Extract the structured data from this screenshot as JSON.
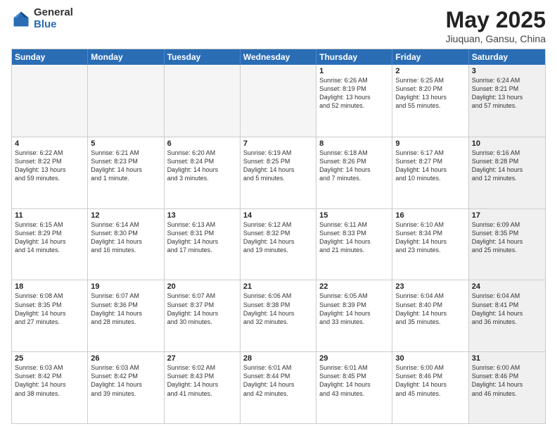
{
  "logo": {
    "general": "General",
    "blue": "Blue"
  },
  "header": {
    "title": "May 2025",
    "subtitle": "Jiuquan, Gansu, China"
  },
  "days": [
    "Sunday",
    "Monday",
    "Tuesday",
    "Wednesday",
    "Thursday",
    "Friday",
    "Saturday"
  ],
  "weeks": [
    [
      {
        "day": "",
        "info": "",
        "empty": true
      },
      {
        "day": "",
        "info": "",
        "empty": true
      },
      {
        "day": "",
        "info": "",
        "empty": true
      },
      {
        "day": "",
        "info": "",
        "empty": true
      },
      {
        "day": "1",
        "info": "Sunrise: 6:26 AM\nSunset: 8:19 PM\nDaylight: 13 hours\nand 52 minutes.",
        "empty": false
      },
      {
        "day": "2",
        "info": "Sunrise: 6:25 AM\nSunset: 8:20 PM\nDaylight: 13 hours\nand 55 minutes.",
        "empty": false
      },
      {
        "day": "3",
        "info": "Sunrise: 6:24 AM\nSunset: 8:21 PM\nDaylight: 13 hours\nand 57 minutes.",
        "empty": false,
        "shaded": true
      }
    ],
    [
      {
        "day": "4",
        "info": "Sunrise: 6:22 AM\nSunset: 8:22 PM\nDaylight: 13 hours\nand 59 minutes.",
        "empty": false
      },
      {
        "day": "5",
        "info": "Sunrise: 6:21 AM\nSunset: 8:23 PM\nDaylight: 14 hours\nand 1 minute.",
        "empty": false
      },
      {
        "day": "6",
        "info": "Sunrise: 6:20 AM\nSunset: 8:24 PM\nDaylight: 14 hours\nand 3 minutes.",
        "empty": false
      },
      {
        "day": "7",
        "info": "Sunrise: 6:19 AM\nSunset: 8:25 PM\nDaylight: 14 hours\nand 5 minutes.",
        "empty": false
      },
      {
        "day": "8",
        "info": "Sunrise: 6:18 AM\nSunset: 8:26 PM\nDaylight: 14 hours\nand 7 minutes.",
        "empty": false
      },
      {
        "day": "9",
        "info": "Sunrise: 6:17 AM\nSunset: 8:27 PM\nDaylight: 14 hours\nand 10 minutes.",
        "empty": false
      },
      {
        "day": "10",
        "info": "Sunrise: 6:16 AM\nSunset: 8:28 PM\nDaylight: 14 hours\nand 12 minutes.",
        "empty": false,
        "shaded": true
      }
    ],
    [
      {
        "day": "11",
        "info": "Sunrise: 6:15 AM\nSunset: 8:29 PM\nDaylight: 14 hours\nand 14 minutes.",
        "empty": false
      },
      {
        "day": "12",
        "info": "Sunrise: 6:14 AM\nSunset: 8:30 PM\nDaylight: 14 hours\nand 16 minutes.",
        "empty": false
      },
      {
        "day": "13",
        "info": "Sunrise: 6:13 AM\nSunset: 8:31 PM\nDaylight: 14 hours\nand 17 minutes.",
        "empty": false
      },
      {
        "day": "14",
        "info": "Sunrise: 6:12 AM\nSunset: 8:32 PM\nDaylight: 14 hours\nand 19 minutes.",
        "empty": false
      },
      {
        "day": "15",
        "info": "Sunrise: 6:11 AM\nSunset: 8:33 PM\nDaylight: 14 hours\nand 21 minutes.",
        "empty": false
      },
      {
        "day": "16",
        "info": "Sunrise: 6:10 AM\nSunset: 8:34 PM\nDaylight: 14 hours\nand 23 minutes.",
        "empty": false
      },
      {
        "day": "17",
        "info": "Sunrise: 6:09 AM\nSunset: 8:35 PM\nDaylight: 14 hours\nand 25 minutes.",
        "empty": false,
        "shaded": true
      }
    ],
    [
      {
        "day": "18",
        "info": "Sunrise: 6:08 AM\nSunset: 8:35 PM\nDaylight: 14 hours\nand 27 minutes.",
        "empty": false
      },
      {
        "day": "19",
        "info": "Sunrise: 6:07 AM\nSunset: 8:36 PM\nDaylight: 14 hours\nand 28 minutes.",
        "empty": false
      },
      {
        "day": "20",
        "info": "Sunrise: 6:07 AM\nSunset: 8:37 PM\nDaylight: 14 hours\nand 30 minutes.",
        "empty": false
      },
      {
        "day": "21",
        "info": "Sunrise: 6:06 AM\nSunset: 8:38 PM\nDaylight: 14 hours\nand 32 minutes.",
        "empty": false
      },
      {
        "day": "22",
        "info": "Sunrise: 6:05 AM\nSunset: 8:39 PM\nDaylight: 14 hours\nand 33 minutes.",
        "empty": false
      },
      {
        "day": "23",
        "info": "Sunrise: 6:04 AM\nSunset: 8:40 PM\nDaylight: 14 hours\nand 35 minutes.",
        "empty": false
      },
      {
        "day": "24",
        "info": "Sunrise: 6:04 AM\nSunset: 8:41 PM\nDaylight: 14 hours\nand 36 minutes.",
        "empty": false,
        "shaded": true
      }
    ],
    [
      {
        "day": "25",
        "info": "Sunrise: 6:03 AM\nSunset: 8:42 PM\nDaylight: 14 hours\nand 38 minutes.",
        "empty": false
      },
      {
        "day": "26",
        "info": "Sunrise: 6:03 AM\nSunset: 8:42 PM\nDaylight: 14 hours\nand 39 minutes.",
        "empty": false
      },
      {
        "day": "27",
        "info": "Sunrise: 6:02 AM\nSunset: 8:43 PM\nDaylight: 14 hours\nand 41 minutes.",
        "empty": false
      },
      {
        "day": "28",
        "info": "Sunrise: 6:01 AM\nSunset: 8:44 PM\nDaylight: 14 hours\nand 42 minutes.",
        "empty": false
      },
      {
        "day": "29",
        "info": "Sunrise: 6:01 AM\nSunset: 8:45 PM\nDaylight: 14 hours\nand 43 minutes.",
        "empty": false
      },
      {
        "day": "30",
        "info": "Sunrise: 6:00 AM\nSunset: 8:46 PM\nDaylight: 14 hours\nand 45 minutes.",
        "empty": false
      },
      {
        "day": "31",
        "info": "Sunrise: 6:00 AM\nSunset: 8:46 PM\nDaylight: 14 hours\nand 46 minutes.",
        "empty": false,
        "shaded": true
      }
    ]
  ]
}
